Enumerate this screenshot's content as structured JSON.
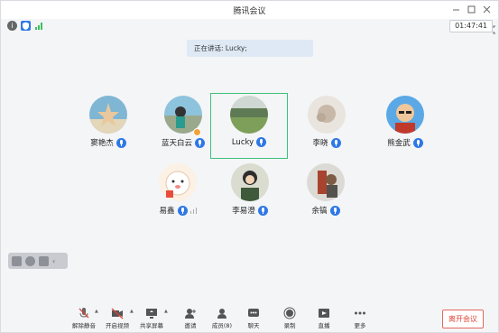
{
  "window": {
    "title": "腾讯会议"
  },
  "status": {
    "timer": "01:47:41"
  },
  "banner": {
    "speaking_text": "正在讲话: Lucky;"
  },
  "participants": [
    {
      "name": "窦艳杰"
    },
    {
      "name": "蓝天白云"
    },
    {
      "name": "Lucky"
    },
    {
      "name": "李晓"
    },
    {
      "name": "熊金武"
    },
    {
      "name": "易鑫"
    },
    {
      "name": "李易澄"
    },
    {
      "name": "余镐"
    }
  ],
  "toolbar": {
    "items": [
      {
        "label": "解除静音"
      },
      {
        "label": "开启视频"
      },
      {
        "label": "共享屏幕"
      },
      {
        "label": "邀请"
      },
      {
        "label": "成员(8)"
      },
      {
        "label": "聊天"
      },
      {
        "label": "录制"
      },
      {
        "label": "直播"
      },
      {
        "label": "更多"
      }
    ],
    "leave_label": "离开会议"
  },
  "colors": {
    "accent": "#2f78e6",
    "active_frame": "#3cc27b",
    "leave": "#e0453a"
  }
}
